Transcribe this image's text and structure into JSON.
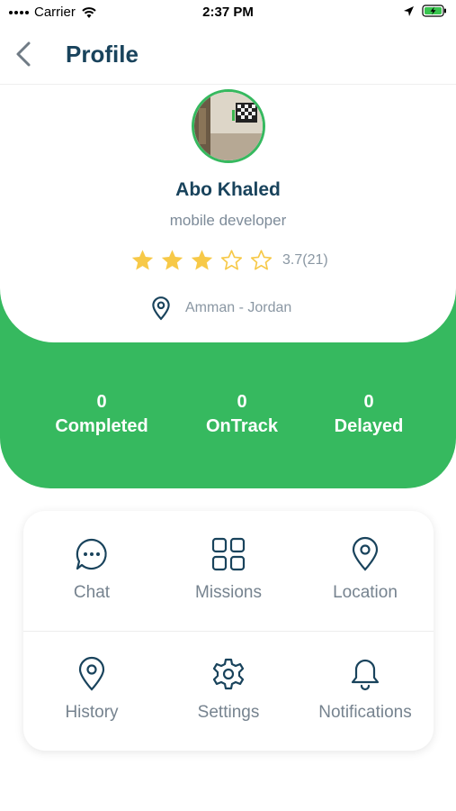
{
  "status_bar": {
    "carrier": "Carrier",
    "time": "2:37 PM"
  },
  "header": {
    "title": "Profile"
  },
  "profile": {
    "name": "Abo Khaled",
    "role": "mobile developer",
    "rating_text": "3.7(21)",
    "filled_stars": 3,
    "total_stars": 5,
    "location": "Amman - Jordan"
  },
  "stats": [
    {
      "value": "0",
      "label": "Completed"
    },
    {
      "value": "0",
      "label": "OnTrack"
    },
    {
      "value": "0",
      "label": "Delayed"
    }
  ],
  "menu": [
    {
      "label": "Chat",
      "icon": "chat-bubble-icon"
    },
    {
      "label": "Missions",
      "icon": "grid-icon"
    },
    {
      "label": "Location",
      "icon": "map-pin-icon"
    },
    {
      "label": "History",
      "icon": "map-pin-icon"
    },
    {
      "label": "Settings",
      "icon": "gear-icon"
    },
    {
      "label": "Notifications",
      "icon": "bell-icon"
    }
  ],
  "colors": {
    "brand_green": "#36b95f",
    "title_navy": "#19435c",
    "star_gold": "#f7c948",
    "muted_text": "#76838f"
  }
}
